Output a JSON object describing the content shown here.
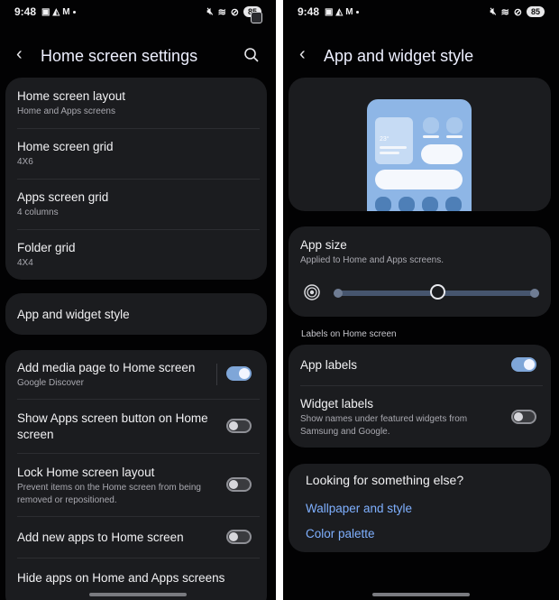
{
  "left": {
    "status": {
      "time": "9:48",
      "battery": "85"
    },
    "title": "Home screen settings",
    "group1": [
      {
        "title": "Home screen layout",
        "subtitle": "Home and Apps screens"
      },
      {
        "title": "Home screen grid",
        "subtitle": "4X6"
      },
      {
        "title": "Apps screen grid",
        "subtitle": "4 columns"
      },
      {
        "title": "Folder grid",
        "subtitle": "4X4"
      }
    ],
    "app_widget_style": "App and widget style",
    "toggles": [
      {
        "title": "Add media page to Home screen",
        "subtitle": "Google Discover",
        "on": true
      },
      {
        "title": "Show Apps screen button on Home screen",
        "subtitle": "",
        "on": false
      },
      {
        "title": "Lock Home screen layout",
        "subtitle": "Prevent items on the Home screen from being removed or repositioned.",
        "on": false
      },
      {
        "title": "Add new apps to Home screen",
        "subtitle": "",
        "on": false
      }
    ],
    "last_item": "Hide apps on Home and Apps screens"
  },
  "right": {
    "status": {
      "time": "9:48",
      "battery": "85"
    },
    "title": "App and widget style",
    "preview": {
      "temperature": "23°"
    },
    "app_size": {
      "title": "App size",
      "subtitle": "Applied to Home and Apps screens.",
      "level": 0.5
    },
    "labels_section": "Labels on Home screen",
    "app_labels": {
      "title": "App labels",
      "on": true
    },
    "widget_labels": {
      "title": "Widget labels",
      "subtitle": "Show names under featured widgets from Samsung and Google.",
      "on": false
    },
    "looking": {
      "title": "Looking for something else?",
      "links": [
        "Wallpaper and style",
        "Color palette"
      ]
    }
  },
  "colors": {
    "accent": "#7fa6d8",
    "link": "#7fb0ff",
    "card": "#1b1c1f",
    "background": "#020203"
  },
  "icons": [
    "back-icon",
    "search-icon",
    "gallery-icon",
    "mail-icon",
    "mute-icon",
    "wifi-icon",
    "dnd-icon",
    "battery-icon",
    "app-size-icon",
    "expand-icon"
  ]
}
